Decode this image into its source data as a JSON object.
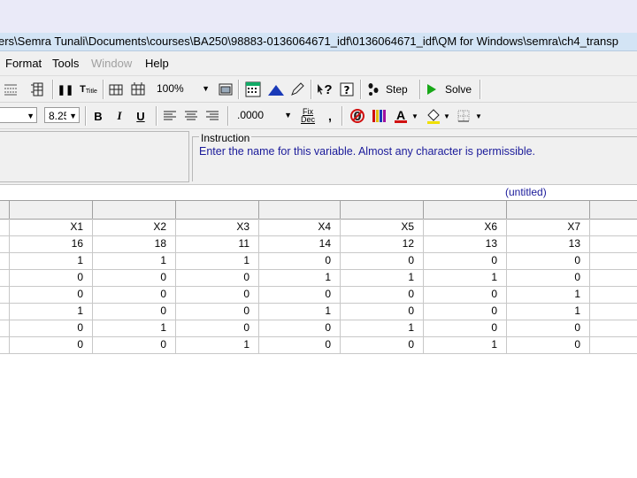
{
  "window": {
    "title": "ers\\Semra Tunali\\Documents\\courses\\BA250\\98883-0136064671_idf\\0136064671_idf\\QM for Windows\\semra\\ch4_transp"
  },
  "menu": [
    {
      "label": "Format",
      "enabled": true
    },
    {
      "label": "Tools",
      "enabled": true
    },
    {
      "label": "Window",
      "enabled": false
    },
    {
      "label": "Help",
      "enabled": true
    }
  ],
  "toolbar1": {
    "zoom_value": "100%",
    "step_label": "Step",
    "solve_label": "Solve",
    "title_label": "Title",
    "solve_color": "#18a818"
  },
  "toolbar2": {
    "font_size_value": "8.25",
    "bold_label": "B",
    "italic_label": "I",
    "underline_label": "U",
    "decimal_value": ".0000",
    "fix_dec_label": "Fix Dec",
    "comma_label": ",",
    "font_color_label": "A",
    "font_color": "#d01010"
  },
  "instruction": {
    "label": "Instruction",
    "text": "Enter the name for this variable. Almost any character is permissible."
  },
  "document": {
    "untitled_label": "(untitled)"
  },
  "table": {
    "headers": [
      "X1",
      "X2",
      "X3",
      "X4",
      "X5",
      "X6",
      "X7"
    ],
    "rows": [
      [
        "16",
        "18",
        "11",
        "14",
        "12",
        "13",
        "13"
      ],
      [
        "1",
        "1",
        "1",
        "0",
        "0",
        "0",
        "0"
      ],
      [
        "0",
        "0",
        "0",
        "1",
        "1",
        "1",
        "0"
      ],
      [
        "0",
        "0",
        "0",
        "0",
        "0",
        "0",
        "1"
      ],
      [
        "1",
        "0",
        "0",
        "1",
        "0",
        "0",
        "1"
      ],
      [
        "0",
        "1",
        "0",
        "0",
        "1",
        "0",
        "0"
      ],
      [
        "0",
        "0",
        "1",
        "0",
        "0",
        "1",
        "0"
      ]
    ]
  }
}
